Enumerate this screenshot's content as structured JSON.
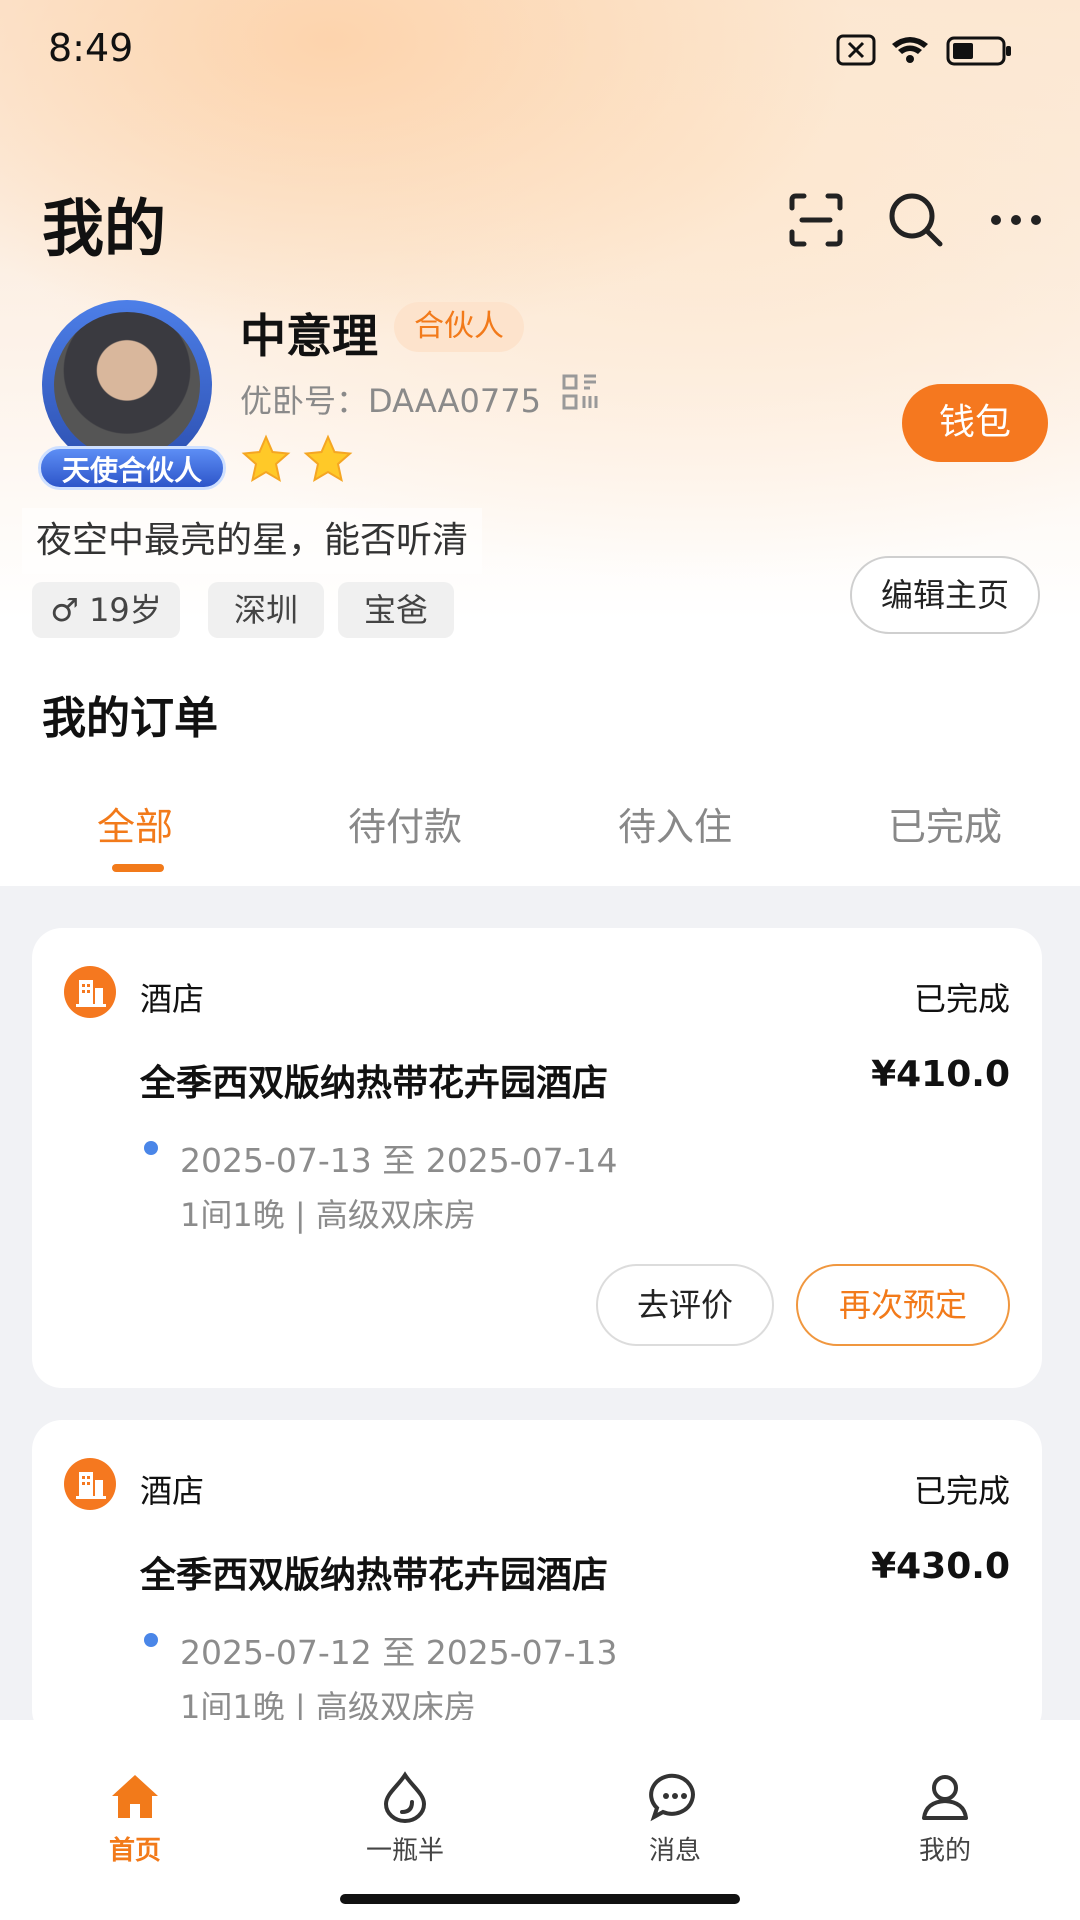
{
  "status_bar": {
    "time": "8:49"
  },
  "header": {
    "title": "我的",
    "icons": [
      "scan-icon",
      "search-icon",
      "more-icon"
    ]
  },
  "profile": {
    "name": "中意理",
    "role_tag": "合伙人",
    "user_id": "优卧号：DAAA0775",
    "avatar_badge": "天使合伙人",
    "stars": 2,
    "wallet_label": "钱包",
    "bio": "夜空中最亮的星，能否听清",
    "tags": [
      "♂ 19岁",
      "深圳",
      "宝爸"
    ],
    "edit_label": "编辑主页"
  },
  "orders": {
    "title": "我的订单",
    "tabs": [
      {
        "label": "全部",
        "active": true
      },
      {
        "label": "待付款",
        "active": false
      },
      {
        "label": "待入住",
        "active": false
      },
      {
        "label": "已完成",
        "active": false
      }
    ],
    "items": [
      {
        "category": "酒店",
        "status": "已完成",
        "hotel_name": "全季西双版纳热带花卉园酒店",
        "price": "¥410.0",
        "dates": "2025-07-13 至 2025-07-14",
        "room": "1间1晚 | 高级双床房",
        "review_label": "去评价",
        "rebook_label": "再次预定"
      },
      {
        "category": "酒店",
        "status": "已完成",
        "hotel_name": "全季西双版纳热带花卉园酒店",
        "price": "¥430.0",
        "dates": "2025-07-12 至 2025-07-13",
        "room": "1间1晚 | 高级双床房"
      }
    ]
  },
  "bottom_nav": [
    {
      "label": "首页",
      "icon": "home-icon",
      "active": true
    },
    {
      "label": "一瓶半",
      "icon": "drop-icon",
      "active": false
    },
    {
      "label": "消息",
      "icon": "message-icon",
      "active": false
    },
    {
      "label": "我的",
      "icon": "profile-icon",
      "active": false
    }
  ],
  "colors": {
    "accent": "#f27a1a",
    "wallet": "#f5781f",
    "dot": "#4a86e8"
  }
}
